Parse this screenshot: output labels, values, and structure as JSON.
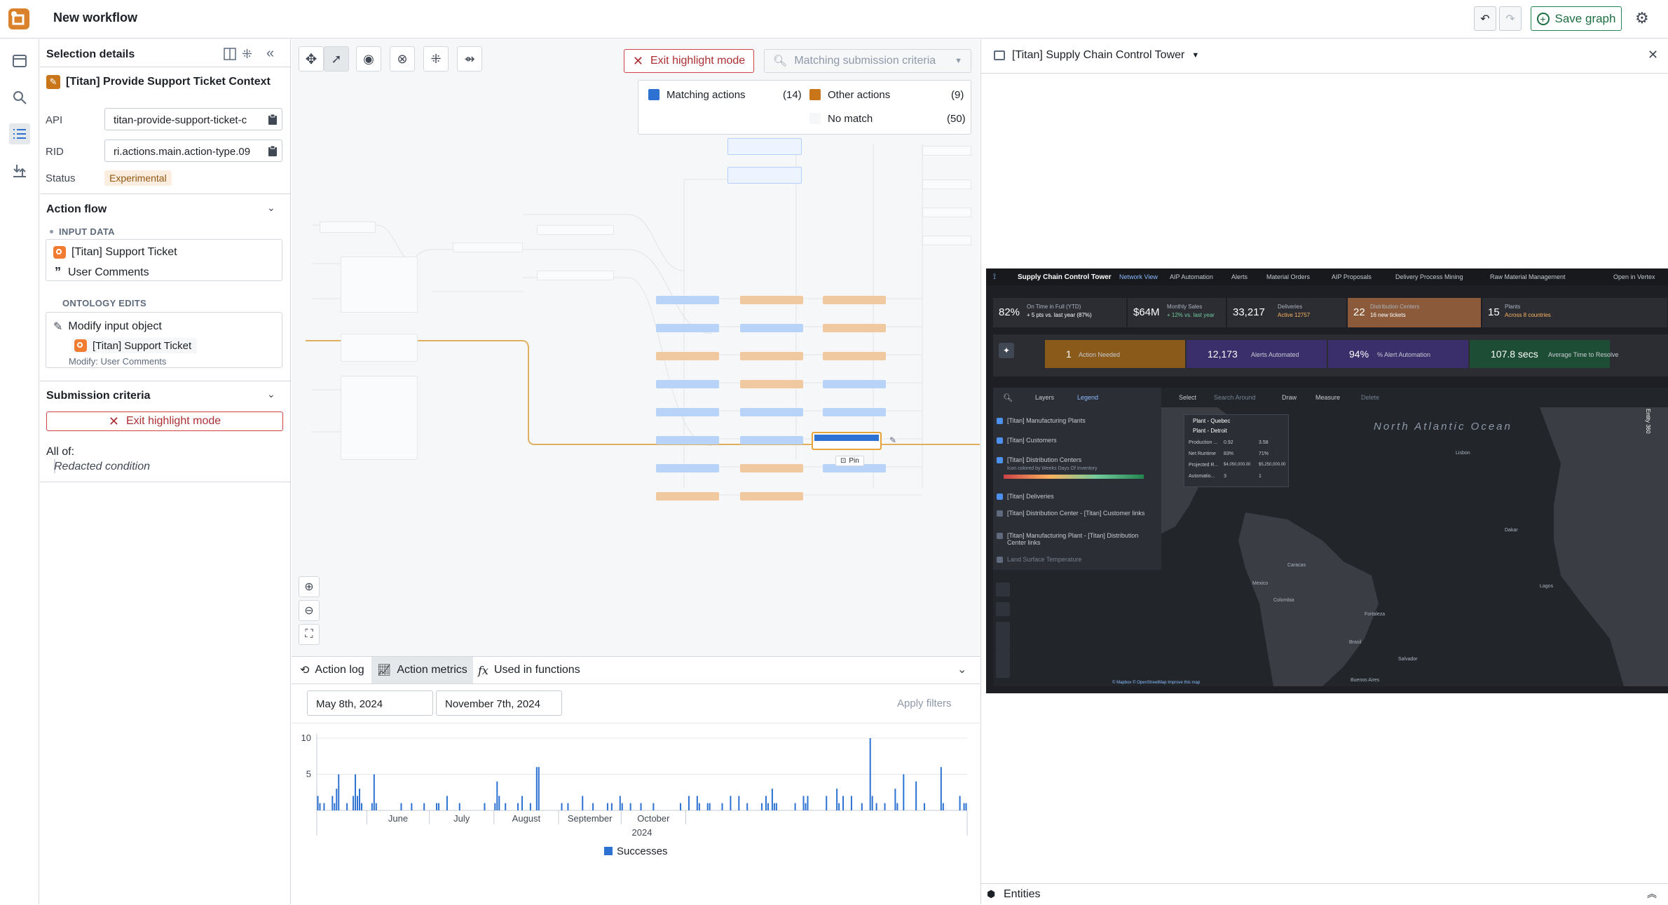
{
  "app": {
    "title": "New workflow",
    "save_label": "Save graph"
  },
  "selection": {
    "title": "Selection details",
    "action_name": "[Titan] Provide Support Ticket Context",
    "api_label": "API",
    "api_value": "titan-provide-support-ticket-c",
    "rid_label": "RID",
    "rid_value": "ri.actions.main.action-type.09",
    "status_label": "Status",
    "status_value": "Experimental"
  },
  "action_flow": {
    "title": "Action flow",
    "input_data_label": "INPUT DATA",
    "input_object": "[Titan] Support Ticket",
    "input_param": "User Comments",
    "ontology_edits_label": "ONTOLOGY EDITS",
    "edit_title": "Modify input object",
    "edit_object": "[Titan] Support Ticket",
    "edit_modify": "Modify: User Comments"
  },
  "submission": {
    "title": "Submission criteria",
    "exit_label": "Exit highlight mode",
    "all_of": "All of:",
    "condition": "Redacted condition"
  },
  "canvas": {
    "exit_label": "Exit highlight mode",
    "search_placeholder": "Matching submission criteria",
    "legend": {
      "matching": "Matching actions",
      "matching_count": "(14)",
      "other": "Other actions",
      "other_count": "(9)",
      "nomatch": "No match",
      "nomatch_count": "(50)"
    },
    "pin_label": "Pin"
  },
  "bottom": {
    "tabs": [
      "Action log",
      "Action metrics",
      "Used in functions"
    ],
    "date_from": "May 8th, 2024",
    "date_to": "November 7th, 2024",
    "apply_label": "Apply filters"
  },
  "colors": {
    "matching": "#2d72d2",
    "other": "#c87619",
    "accent": "#238551"
  },
  "chart_data": {
    "type": "bar",
    "ylim": [
      0,
      10
    ],
    "yticks": [
      5,
      10
    ],
    "month_labels": [
      "June",
      "July",
      "August",
      "September",
      "October"
    ],
    "year_label": "2024",
    "legend": "Successes",
    "x_start": "2024-05-08",
    "values": [
      2,
      1,
      0,
      1,
      0,
      0,
      0,
      2,
      1,
      3,
      5,
      0,
      0,
      0,
      1,
      0,
      0,
      2,
      5,
      2,
      3,
      1,
      0,
      0,
      0,
      0,
      1,
      5,
      1,
      0,
      0,
      0,
      0,
      0,
      0,
      0,
      0,
      0,
      0,
      0,
      1,
      0,
      0,
      0,
      0,
      1,
      0,
      0,
      0,
      0,
      0,
      1,
      0,
      0,
      0,
      0,
      0,
      1,
      1,
      0,
      0,
      0,
      2,
      0,
      0,
      0,
      0,
      0,
      1,
      0,
      0,
      0,
      0,
      0,
      0,
      0,
      0,
      0,
      0,
      0,
      1,
      0,
      0,
      0,
      0,
      1,
      4,
      2,
      0,
      0,
      1,
      0,
      0,
      0,
      0,
      0,
      1,
      0,
      2,
      0,
      0,
      0,
      1,
      0,
      0,
      6,
      6,
      0,
      0,
      0,
      0,
      0,
      0,
      0,
      0,
      0,
      0,
      1,
      0,
      0,
      1,
      0,
      0,
      0,
      0,
      0,
      0,
      2,
      0,
      0,
      0,
      0,
      1,
      0,
      0,
      0,
      0,
      0,
      0,
      1,
      0,
      1,
      0,
      0,
      0,
      2,
      1,
      0,
      0,
      0,
      1,
      0,
      0,
      0,
      0,
      1,
      0,
      0,
      0,
      0,
      0,
      1,
      0,
      0,
      0,
      0,
      0,
      0,
      0,
      0,
      0,
      0,
      0,
      0,
      1,
      0,
      0,
      0,
      2,
      0,
      0,
      0,
      2,
      1,
      0,
      0,
      0,
      1,
      1,
      0,
      0,
      0,
      0,
      0,
      1,
      0,
      0,
      0,
      2,
      0,
      0,
      0,
      2,
      0,
      0,
      0,
      1,
      0,
      0,
      0,
      0,
      0,
      0,
      1,
      0,
      2,
      1,
      0,
      3,
      1,
      1,
      0,
      0,
      0,
      0,
      0,
      0,
      0,
      0,
      1,
      0,
      0,
      0,
      2,
      1,
      2,
      0,
      0,
      0,
      0,
      0,
      0,
      0,
      0,
      2,
      0,
      0,
      0,
      0,
      3,
      1,
      0,
      2,
      0,
      0,
      0,
      2,
      0,
      0,
      0,
      0,
      1,
      0,
      0,
      0,
      10,
      2,
      0,
      1,
      0,
      0,
      0,
      1,
      0,
      0,
      0,
      0,
      3,
      1,
      0,
      0,
      5,
      0,
      0,
      0,
      0,
      0,
      4,
      0,
      0,
      0,
      1,
      0,
      0,
      0,
      0,
      0,
      0,
      0,
      6,
      1,
      0,
      0,
      0,
      0,
      0,
      0,
      0,
      2,
      0,
      1,
      1
    ]
  },
  "right": {
    "title": "[Titan] Supply Chain Control Tower",
    "entities_label": "Entities",
    "dash": {
      "title": "Supply Chain Control Tower",
      "tabs": [
        "Network View",
        "AIP Automation",
        "Alerts",
        "Material Orders",
        "AIP Proposals",
        "Delivery Process Mining",
        "Raw Material Management"
      ],
      "open_label": "Open in Vertex",
      "kpis": [
        {
          "value": "82%",
          "label": "On Time in Full (YTD)",
          "sub": "+ 5 pts vs. last year (87%)"
        },
        {
          "value": "$64M",
          "label": "Monthly Sales",
          "sub": "+ 12% vs. last year"
        },
        {
          "value": "33,217",
          "label": "Deliveries",
          "sub": "Active 12757"
        },
        {
          "value": "22",
          "label": "Distribution Centers",
          "sub": "16 new tickets"
        },
        {
          "value": "15",
          "label": "Plants",
          "sub": "Across 8 countries"
        }
      ],
      "aip": [
        {
          "value": "1",
          "label": "Action Needed"
        },
        {
          "value": "12,173",
          "label": "Alerts Automated"
        },
        {
          "value": "94%",
          "label": "% Alert Automation"
        },
        {
          "value": "107.8 secs",
          "label": "Average Time to Resolve"
        }
      ],
      "map_toolbar": [
        "Layers",
        "Legend",
        "Select",
        "Search Around",
        "Draw",
        "Measure",
        "Delete"
      ],
      "layers": [
        "[Titan] Manufacturing Plants",
        "[Titan] Customers",
        "[Titan] Distribution Centers",
        "Icon colored by Weeks Days Of Inventory",
        "[Titan] Deliveries",
        "[Titan] Distribution Center - [Titan] Customer links",
        "[Titan] Manufacturing Plant - [Titan] Distribution Center links",
        "Land Surface Temperature"
      ],
      "ocean": "North Atlantic Ocean",
      "plants": [
        "Plant - Quebec",
        "Plant - Detroit"
      ],
      "plant_rows": [
        [
          "Production ...",
          "0.92",
          "3.58"
        ],
        [
          "Net Runtime",
          "83%",
          "71%"
        ],
        [
          "Projected R...",
          "$4,050,000.00",
          "$5,250,000.00"
        ],
        [
          "Automatio...",
          "3",
          "1"
        ]
      ],
      "side_label": "Entity 360",
      "cities": [
        "Mexico",
        "Caracas",
        "Colombia",
        "Brasil",
        "Fortaleza",
        "Salvador",
        "Lisbon",
        "Dakar",
        "Lagos",
        "Buenos Aires"
      ],
      "attribution": "© Mapbox © OpenStreetMap Improve this map"
    }
  }
}
